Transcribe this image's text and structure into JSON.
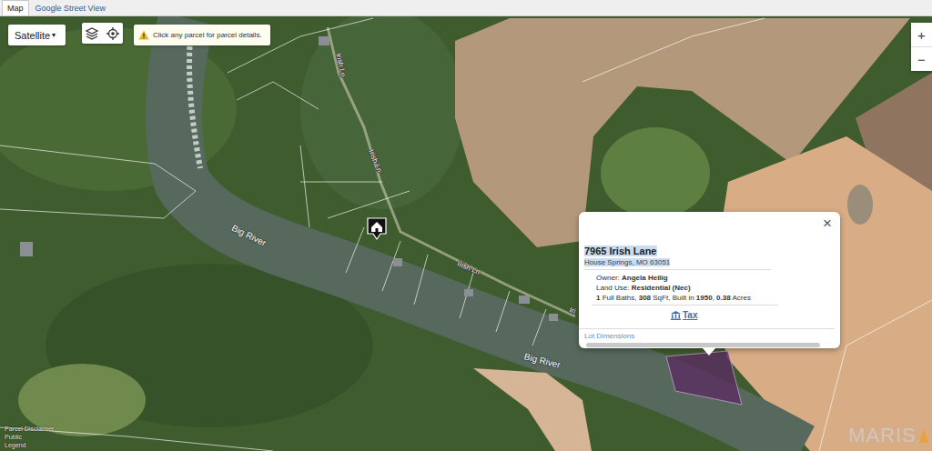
{
  "tabs": [
    {
      "label": "Map",
      "selected": true
    },
    {
      "label": "Google Street View",
      "selected": false
    }
  ],
  "map_type": {
    "label": "Satellite",
    "arrow": "▾"
  },
  "notice": {
    "text": "Click any parcel for parcel details."
  },
  "zoom": [
    "+",
    "−"
  ],
  "map_labels": [
    {
      "text": "Irish Ln",
      "kind": "road"
    },
    {
      "text": "Irish Ln",
      "kind": "road"
    },
    {
      "text": "Irish Ln",
      "kind": "road"
    },
    {
      "text": "Iri",
      "kind": "road"
    },
    {
      "text": "Big River",
      "kind": "river"
    },
    {
      "text": "Big River",
      "kind": "river"
    }
  ],
  "popup": {
    "close": "×",
    "title": "7965 Irish Lane",
    "address": "House Springs, MO 63051",
    "fields": [
      {
        "label": "Owner: ",
        "value": "Angela Heilig"
      },
      {
        "label": "Land Use: ",
        "value": "Residential (Nec)"
      }
    ],
    "stats": [
      {
        "text": "1",
        "bold": true
      },
      {
        "text": " Full Baths, ",
        "bold": false
      },
      {
        "text": "308",
        "bold": true
      },
      {
        "text": " SqFt, Built in ",
        "bold": false
      },
      {
        "text": "1950",
        "bold": true
      },
      {
        "text": ", ",
        "bold": false
      },
      {
        "text": "0.38",
        "bold": true
      },
      {
        "text": " Acres",
        "bold": false
      }
    ],
    "tax_link": "Tax",
    "lot_link": "Lot Dimensions"
  },
  "footer_links": [
    "Parcel Disclaimer",
    "Public",
    "Legend"
  ],
  "watermark": "MARIS"
}
